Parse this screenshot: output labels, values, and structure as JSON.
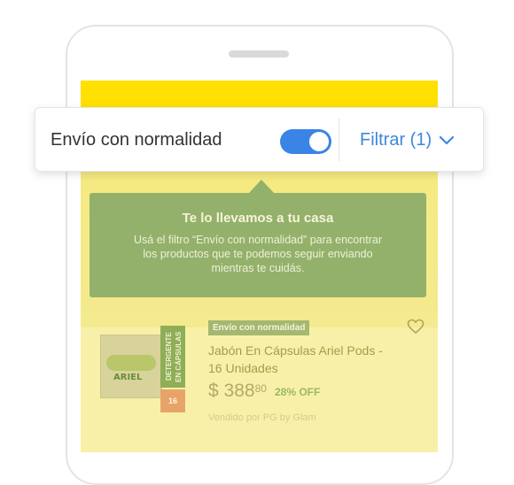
{
  "toolbar": {
    "toggle_label": "Envío con normalidad",
    "toggle_on": true,
    "filter_label": "Filtrar (1)",
    "filter_icon": "chevron-down-icon"
  },
  "info_banner": {
    "title": "Te lo llevamos a tu casa",
    "body": "Usá el filtro “Envío con normalidad” para encontrar los productos que te podemos seguir enviando mientras te cuidás."
  },
  "product": {
    "badge": "Envío con normalidad",
    "title": "Jabón En Cápsulas Ariel Pods - 16 Unidades",
    "price_currency": "$",
    "price_int": "388",
    "price_cents": "80",
    "discount": "28% OFF",
    "seller": "Vendido por PG by Glam",
    "image_brand": "ARIEL",
    "image_side_text": "DETERGENTE EN CÁPSULAS",
    "image_count": "16",
    "favorite_icon": "heart-outline-icon"
  },
  "colors": {
    "accent_blue": "#3a84e6",
    "brand_yellow": "#ffe000",
    "banner_green": "#93b16b"
  }
}
